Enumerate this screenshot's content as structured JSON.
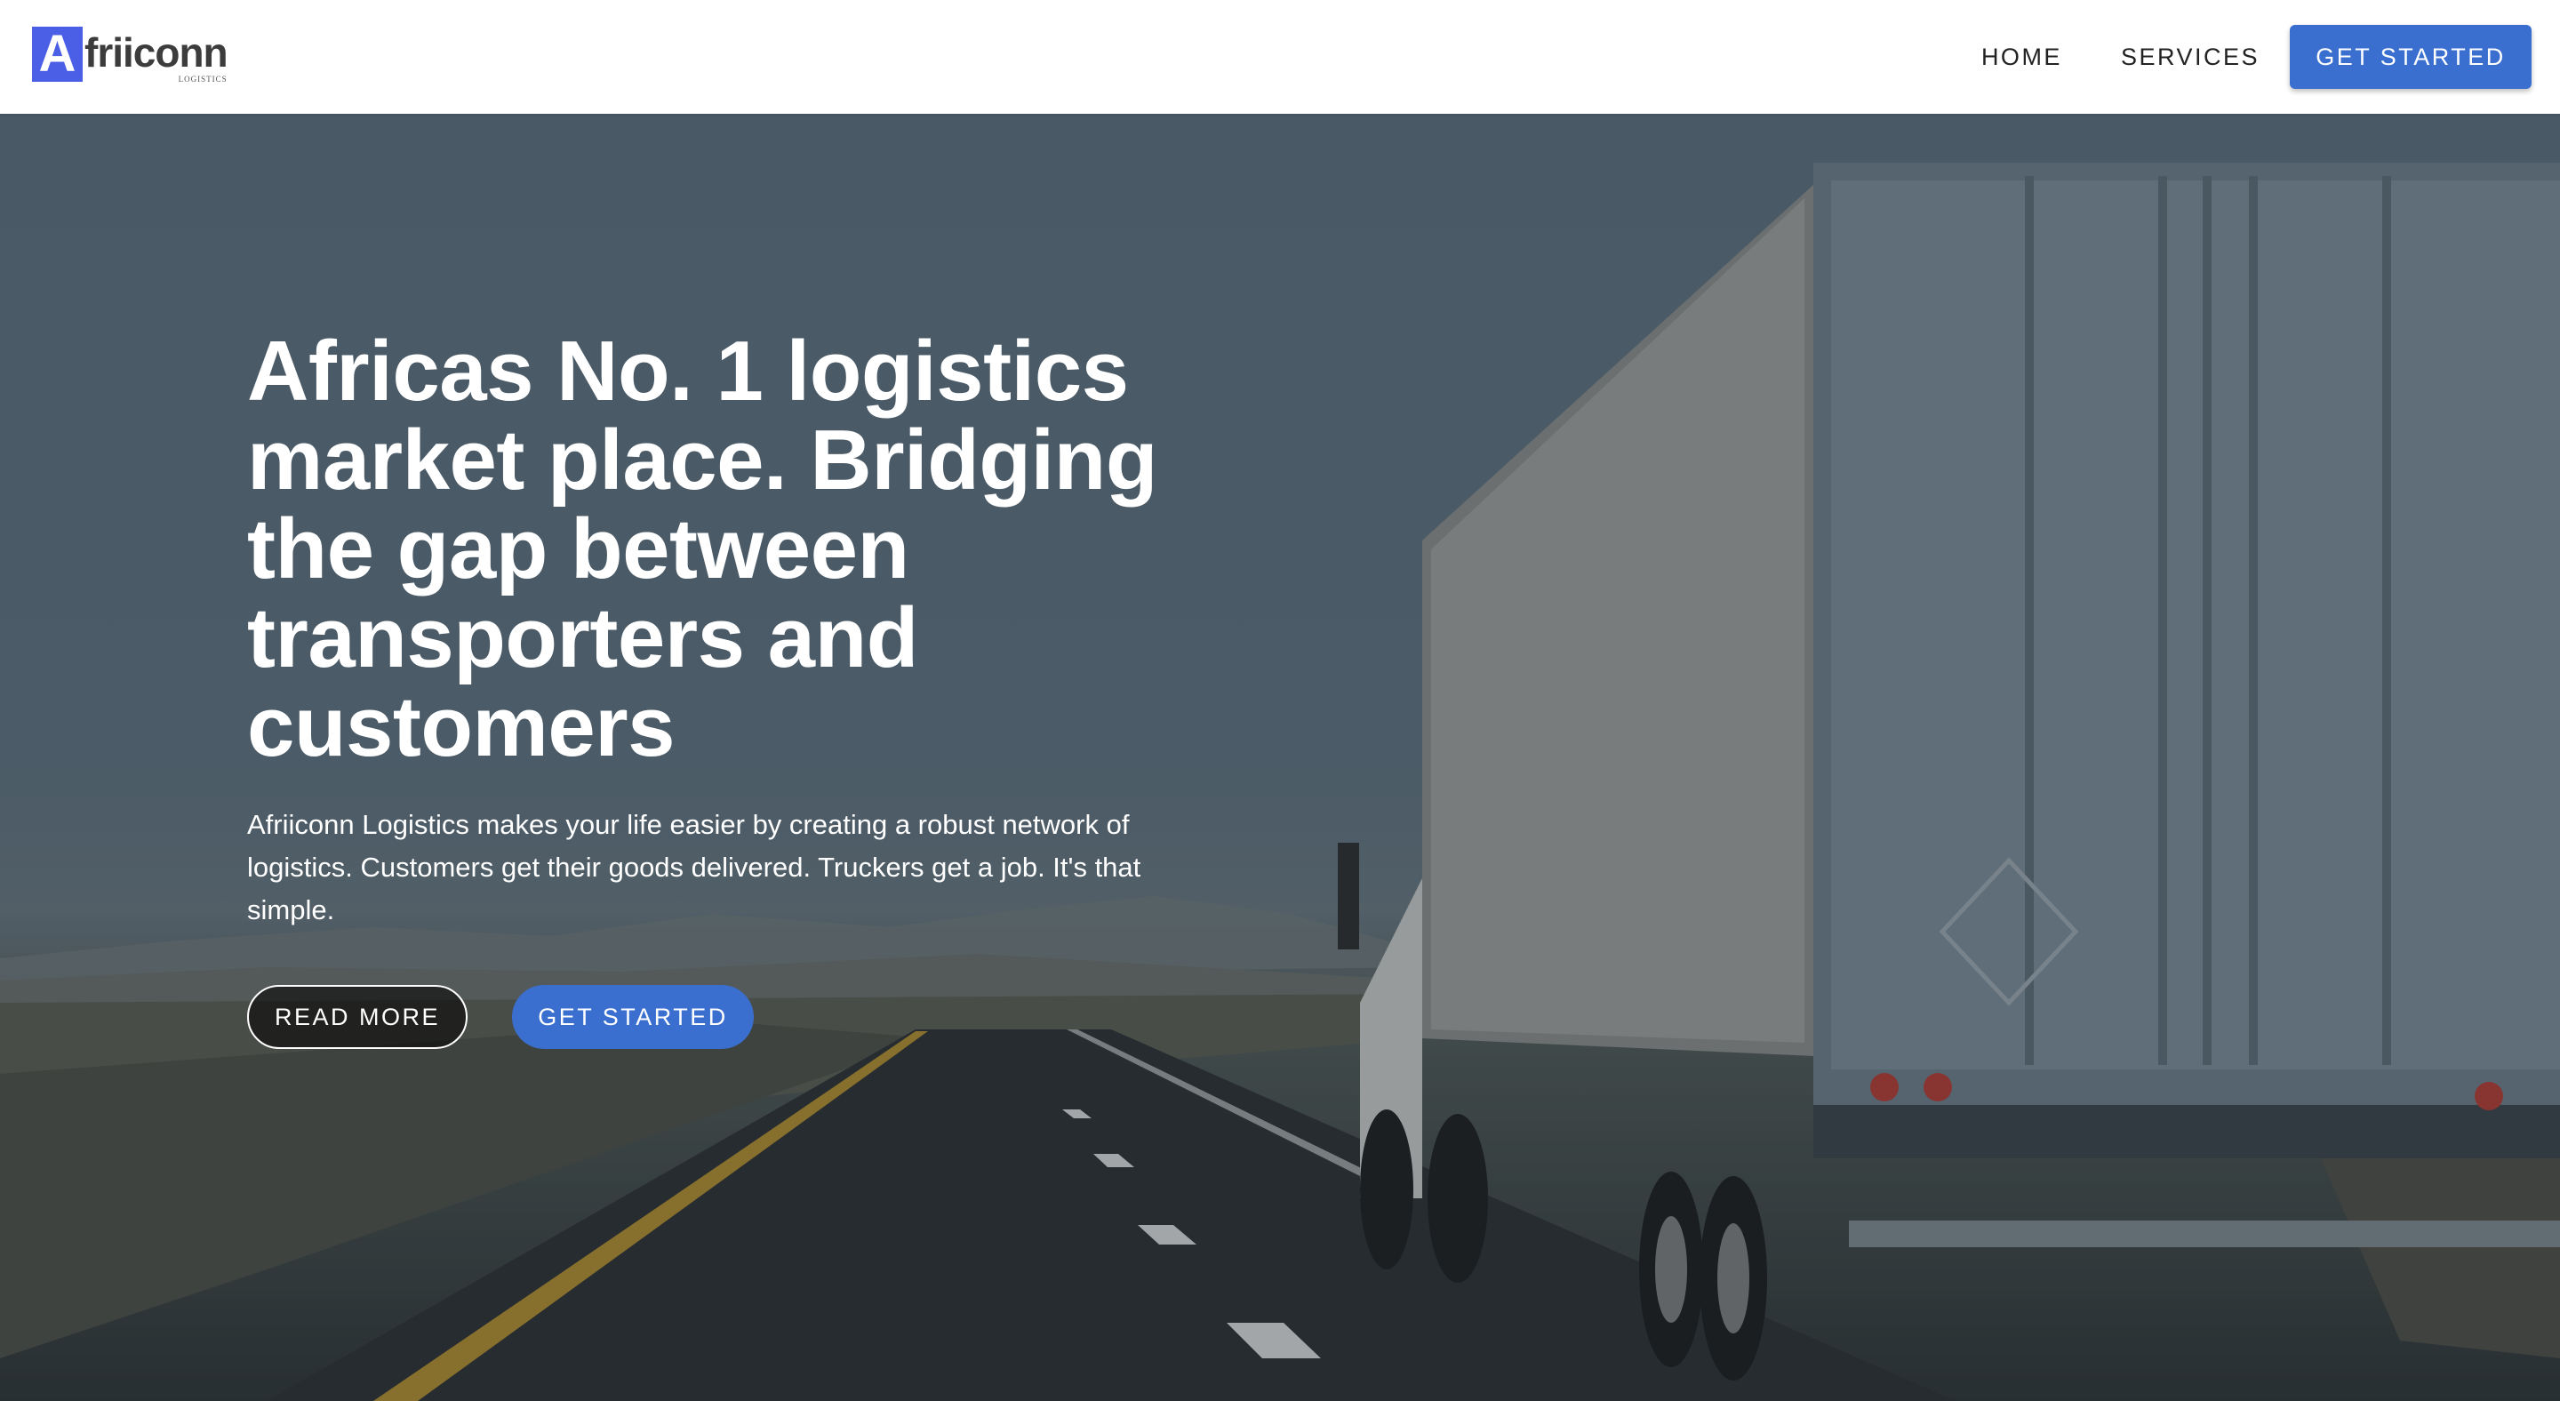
{
  "header": {
    "logo": {
      "mark": "A",
      "name": "friiconn",
      "tagline": "LOGISTICS"
    },
    "nav": [
      {
        "label": "HOME"
      },
      {
        "label": "SERVICES"
      }
    ],
    "cta_label": "GET STARTED"
  },
  "hero": {
    "title": "Africas No. 1 logistics market place. Bridging the gap between transporters and customers",
    "description": "Afriiconn Logistics makes your life easier by creating a robust network of logistics. Customers get their goods delivered. Truckers get a job. It's that simple.",
    "read_more_label": "READ MORE",
    "get_started_label": "GET STARTED",
    "background_image": "truck-on-highway"
  },
  "colors": {
    "accent": "#3a6fcf",
    "logo_mark": "#4a5ee6",
    "hero_text": "#ffffff"
  }
}
